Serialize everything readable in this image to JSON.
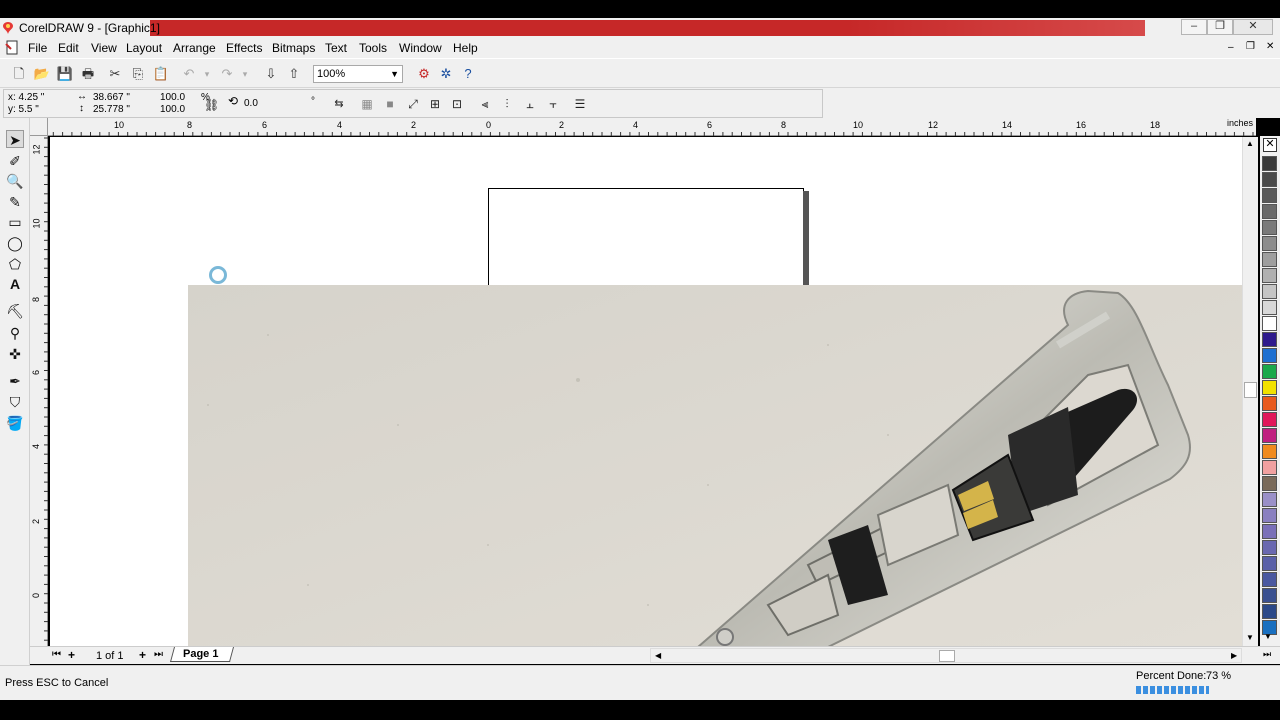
{
  "window": {
    "title": "CorelDRAW 9 - [Graphic1]",
    "minimize": "–",
    "restore": "❐",
    "close": "✕"
  },
  "menu": [
    "File",
    "Edit",
    "View",
    "Layout",
    "Arrange",
    "Effects",
    "Bitmaps",
    "Text",
    "Tools",
    "Window",
    "Help"
  ],
  "toolbar": {
    "zoom": "100%"
  },
  "property_bar": {
    "x": "x: 4.25 \"",
    "y": "y: 5.5 \"",
    "width": "38.667 \"",
    "height": "25.778 \"",
    "scale_x": "100.0",
    "scale_y": "100.0",
    "percent": "%",
    "rotation": "0.0",
    "degree": "°"
  },
  "ruler": {
    "units": "inches",
    "h_ticks": [
      "10",
      "8",
      "6",
      "4",
      "2",
      "0",
      "2",
      "4",
      "6",
      "8",
      "10",
      "12",
      "14",
      "16",
      "18"
    ],
    "v_ticks": [
      "12",
      "10",
      "8",
      "6",
      "4",
      "2",
      "0"
    ]
  },
  "page_nav": {
    "count": "1 of 1",
    "tab": "Page 1"
  },
  "status": {
    "hint": "Press ESC to Cancel",
    "percent_label": "Percent Done:",
    "percent_value": "73 %",
    "progress": 0.73
  },
  "palette": [
    "#3a3a3a",
    "#4a4a4a",
    "#595959",
    "#6a6a6a",
    "#7a7a7a",
    "#8c8c8c",
    "#9e9e9e",
    "#b0b0b0",
    "#c4c4c4",
    "#d8d8d8",
    "#ffffff",
    "#2e1a8c",
    "#1e6fd0",
    "#1aa84a",
    "#f2e200",
    "#e85a1e",
    "#e0185a",
    "#c02080",
    "#f08a1e",
    "#f0a0a0",
    "#7a6a5a",
    "#9a90c8",
    "#8a80c0",
    "#7a70b8",
    "#6a68b0",
    "#5a60a8",
    "#4a58a0",
    "#3a5090",
    "#2a4888",
    "#1a70c0"
  ]
}
